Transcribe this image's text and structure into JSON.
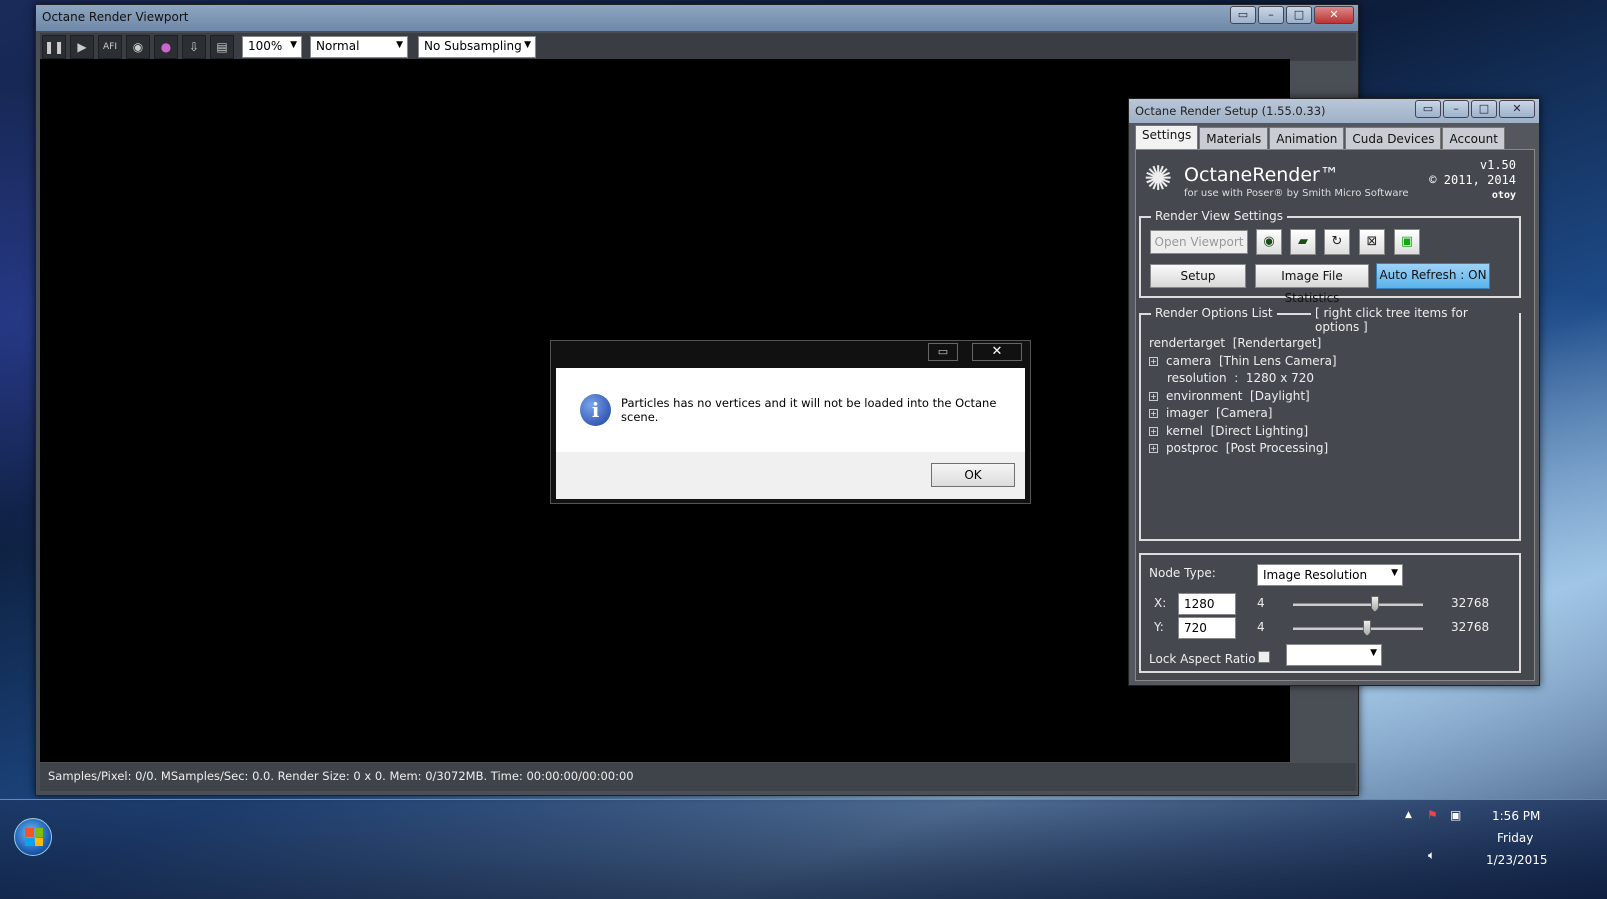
{
  "viewport": {
    "title": "Octane Render Viewport",
    "toolbar": {
      "icons": [
        "pause-icon",
        "play-icon",
        "afi-icon",
        "color-wheel-icon",
        "channels-icon",
        "save-render-icon",
        "clipboard-icon"
      ],
      "zoom": "100%",
      "mode": "Normal",
      "subsampling": "No Subsampling"
    },
    "status": "Samples/Pixel: 0/0. MSamples/Sec: 0.0. Render Size: 0 x 0. Mem: 0/3072MB. Time: 00:00:00/00:00:00"
  },
  "dialog": {
    "message": "Particles has no vertices and it will not be loaded into the Octane scene.",
    "ok_label": "OK",
    "icon": "info-icon"
  },
  "setup": {
    "title": "Octane Render Setup (1.55.0.33)",
    "tabs": [
      "Settings",
      "Materials",
      "Animation",
      "Cuda Devices",
      "Account"
    ],
    "active_tab": "Settings",
    "logo": {
      "title": "OctaneRender™",
      "subtitle": "for use with Poser® by Smith Micro Software",
      "version": "v1.50",
      "copyright": "© 2011, 2014",
      "brand": "otoy"
    },
    "render_view": {
      "legend": "Render View Settings",
      "open_viewport": "Open Viewport",
      "setup": "Setup",
      "image_stats": "Image File Statistics",
      "auto_refresh": "Auto Refresh : ON"
    },
    "options": {
      "legend": "Render Options List",
      "hint": "[ right click tree items for options ]",
      "tree": {
        "root": "rendertarget  [Rendertarget]",
        "items": [
          {
            "label": "camera  [Thin Lens Camera]",
            "expandable": true
          },
          {
            "label": "resolution  :  1280 x 720",
            "expandable": false
          },
          {
            "label": "environment  [Daylight]",
            "expandable": true
          },
          {
            "label": "imager  [Camera]",
            "expandable": true
          },
          {
            "label": "kernel  [Direct Lighting]",
            "expandable": true
          },
          {
            "label": "postproc  [Post Processing]",
            "expandable": true
          }
        ]
      }
    },
    "node": {
      "type_label": "Node Type:",
      "type_value": "Image Resolution",
      "x_label": "X:",
      "x_value": "1280",
      "y_label": "Y:",
      "y_value": "720",
      "min": "4",
      "max": "32768",
      "x_slider_fraction": 0.63,
      "y_slider_fraction": 0.57,
      "lock_label": "Lock Aspect Ratio",
      "lock_checked": false,
      "aspect_value": ""
    }
  },
  "taskbar": {
    "time": "1:56 PM",
    "day": "Friday",
    "date": "1/23/2015"
  }
}
